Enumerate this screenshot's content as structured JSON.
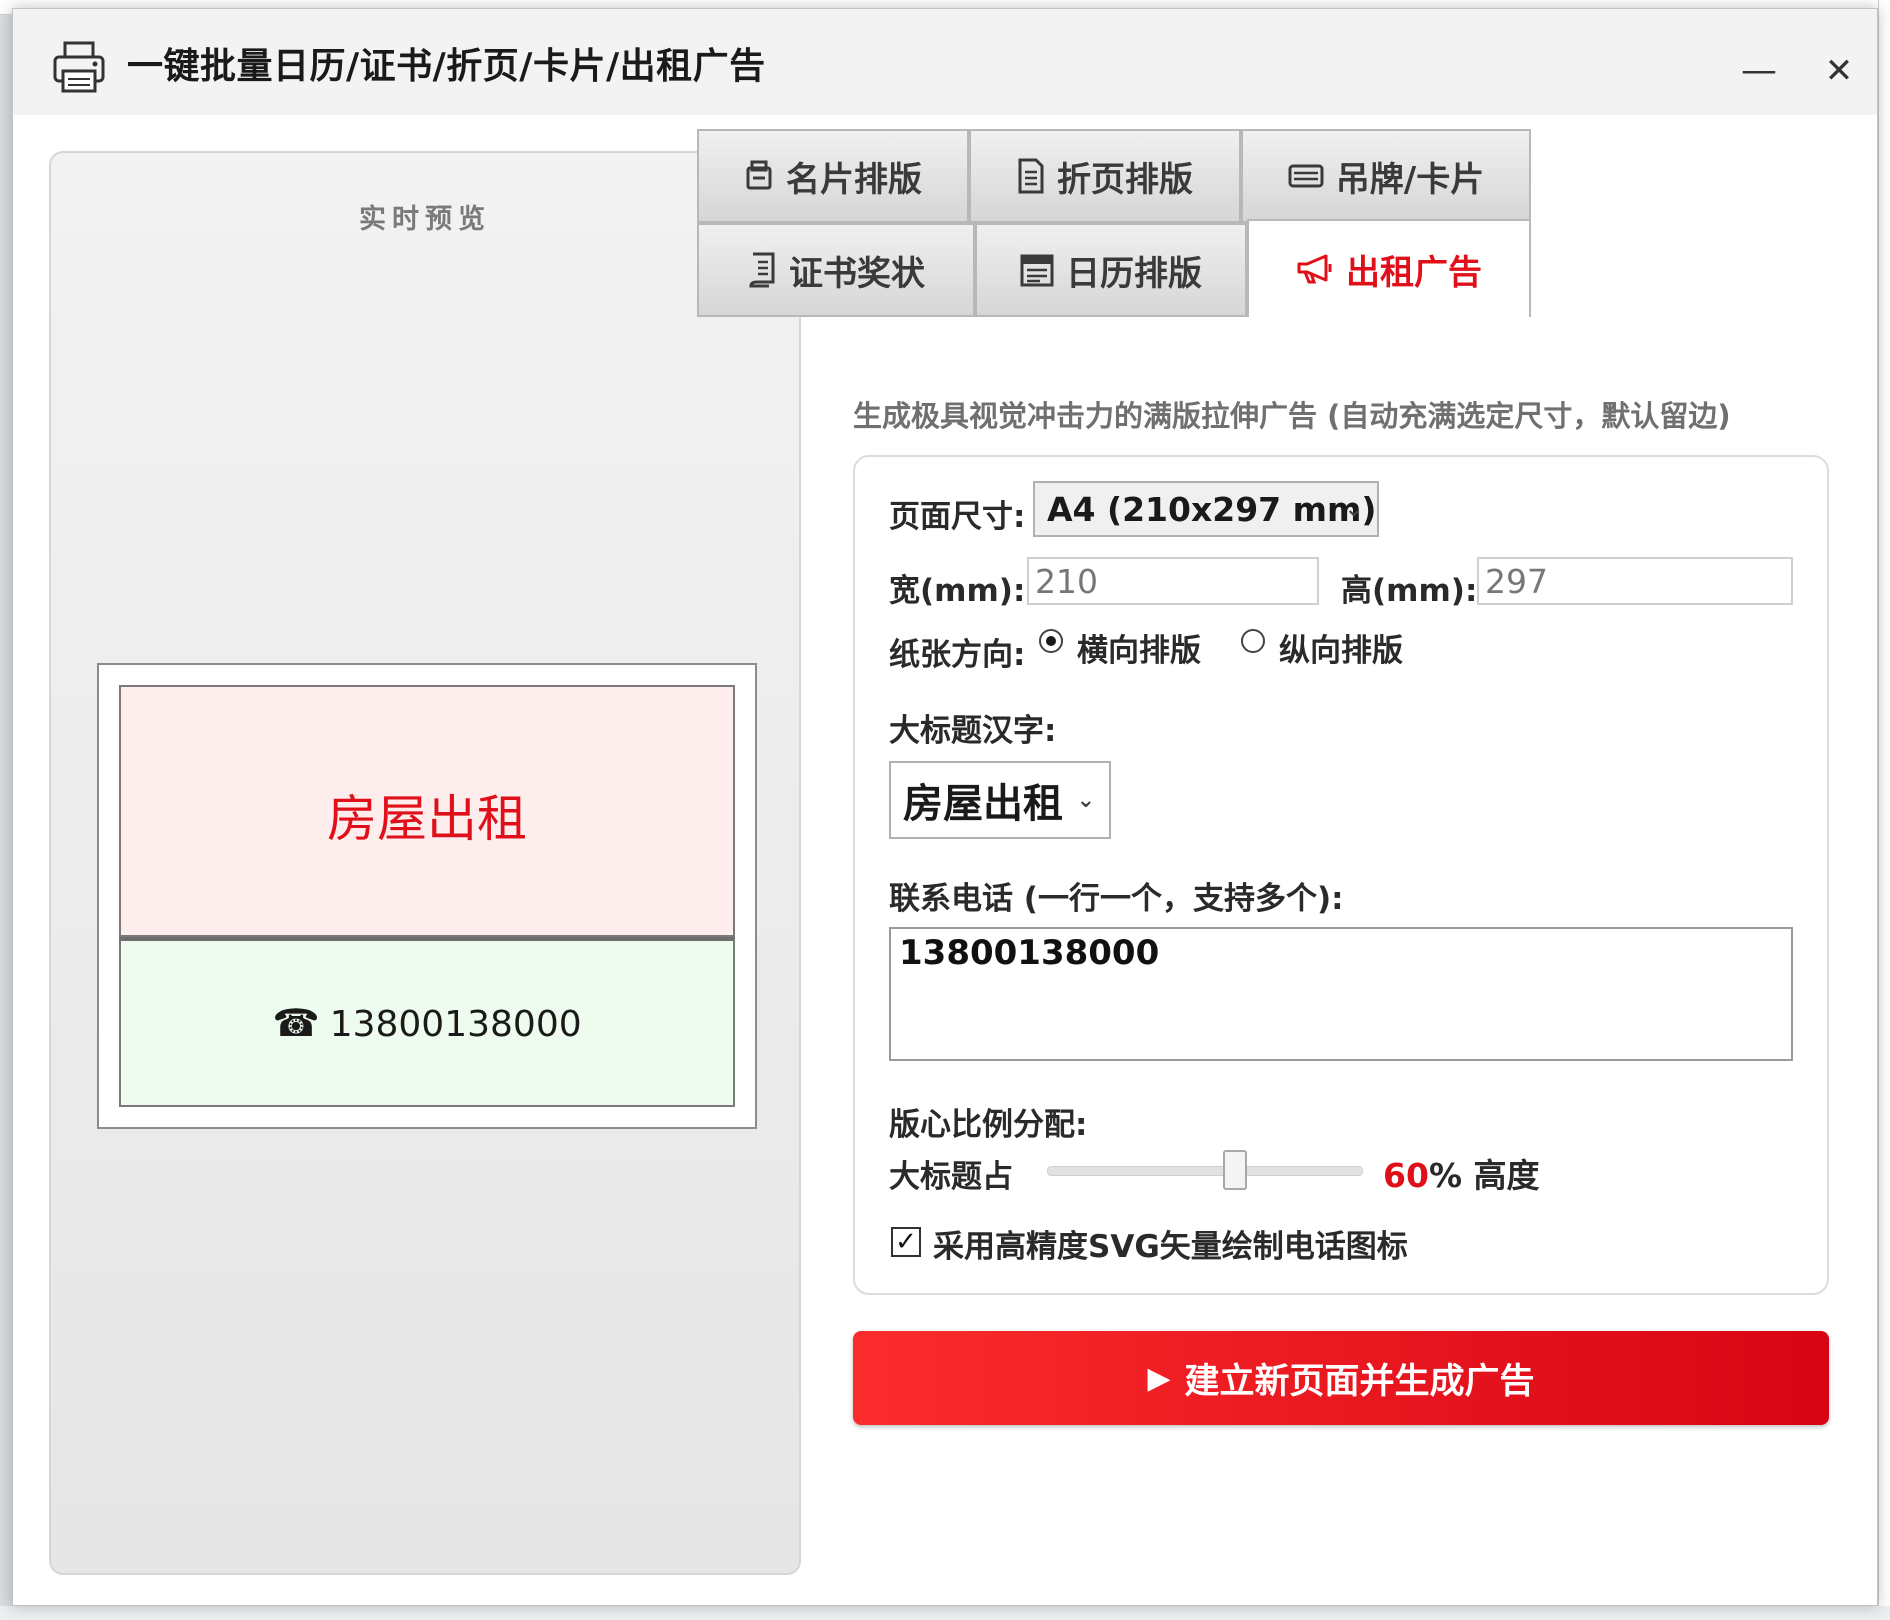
{
  "window": {
    "title": "一键批量日历/证书/折页/卡片/出租广告",
    "minimize": "—",
    "close": "✕"
  },
  "preview": {
    "title": "实时预览",
    "ad_title": "房屋出租",
    "phone_icon": "☎",
    "phone": "13800138000"
  },
  "tabs": [
    {
      "label": "名片排版",
      "icon": "card-stack-icon"
    },
    {
      "label": "折页排版",
      "icon": "document-icon"
    },
    {
      "label": "吊牌/卡片",
      "icon": "tag-card-icon"
    },
    {
      "label": "证书奖状",
      "icon": "certificate-icon"
    },
    {
      "label": "日历排版",
      "icon": "calendar-icon"
    },
    {
      "label": "出租广告",
      "icon": "megaphone-icon",
      "active": true
    }
  ],
  "description": "生成极具视觉冲击力的满版拉伸广告 (自动充满选定尺寸，默认留边)",
  "form": {
    "page_size_label": "页面尺寸:",
    "page_size_value": "A4 (210x297 mm)",
    "width_label": "宽(mm):",
    "width_value": "210",
    "height_label": "高(mm):",
    "height_value": "297",
    "orientation_label": "纸张方向:",
    "orientation_landscape": "横向排版",
    "orientation_portrait": "纵向排版",
    "orientation_selected": "横向排版",
    "headline_label": "大标题汉字:",
    "headline_value": "房屋出租",
    "phones_label": "联系电话 (一行一个，支持多个):",
    "phones_value": "13800138000",
    "ratio_label": "版心比例分配:",
    "ratio_prefix": "大标题占",
    "ratio_value": "60",
    "ratio_suffix": "% 高度",
    "ratio_fraction": 0.6,
    "svg_checkbox_label": "采用高精度SVG矢量绘制电话图标",
    "svg_checkbox_checked": true
  },
  "generate_button": "建立新页面并生成广告",
  "colors": {
    "accent": "#e0101a",
    "title_bg": "#fdeeed",
    "phone_bg": "#eefcef"
  }
}
